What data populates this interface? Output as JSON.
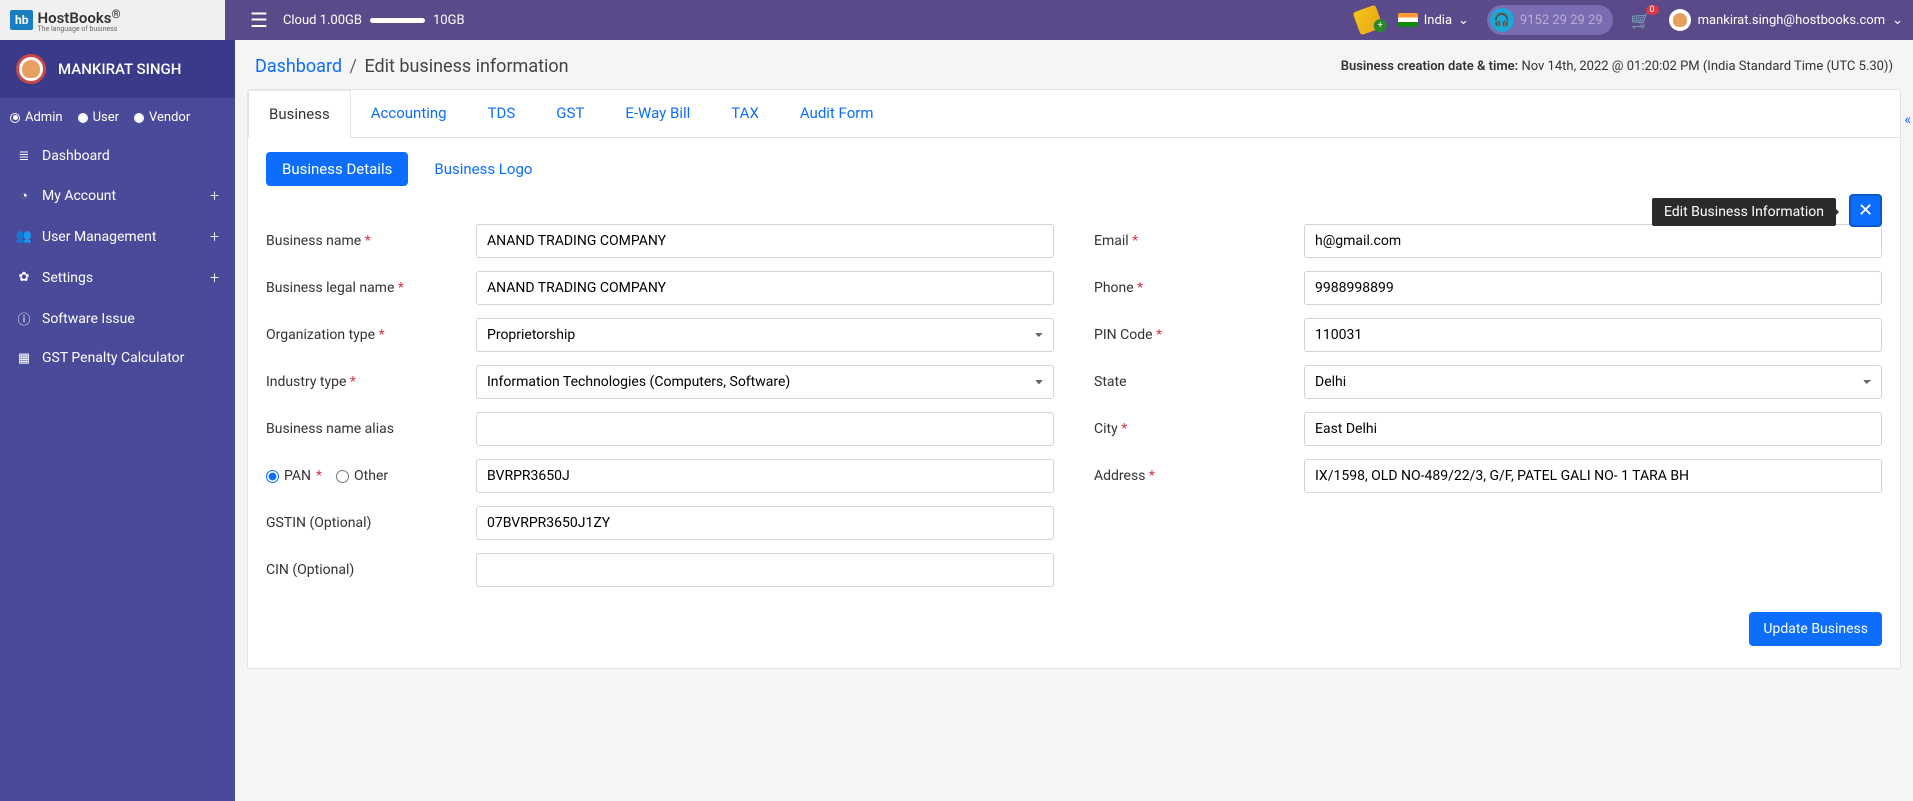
{
  "header": {
    "logo_badge": "hb",
    "logo_text": "HostBooks",
    "logo_sub": "The language of business",
    "cloud_used": "Cloud 1.00GB",
    "cloud_total": "10GB",
    "country_label": "India",
    "phone": "9152 29 29 29",
    "cart_count": "0",
    "user_email": "mankirat.singh@hostbooks.com"
  },
  "sidebar": {
    "user_name": "MANKIRAT SINGH",
    "roles": [
      "Admin",
      "User",
      "Vendor"
    ],
    "items": [
      {
        "icon": "≣",
        "label": "Dashboard",
        "expandable": false
      },
      {
        "icon": "◔",
        "label": "My Account",
        "expandable": true
      },
      {
        "icon": "👥",
        "label": "User Management",
        "expandable": true
      },
      {
        "icon": "✿",
        "label": "Settings",
        "expandable": true
      },
      {
        "icon": "ⓘ",
        "label": "Software Issue",
        "expandable": false
      },
      {
        "icon": "▦",
        "label": "GST Penalty Calculator",
        "expandable": false
      }
    ]
  },
  "breadcrumb": {
    "root": "Dashboard",
    "current": "Edit business information",
    "creation_label": "Business creation date & time:",
    "creation_value": "Nov 14th, 2022 @ 01:20:02 PM (India Standard Time (UTC 5.30))"
  },
  "tabs": [
    "Business",
    "Accounting",
    "TDS",
    "GST",
    "E-Way Bill",
    "TAX",
    "Audit Form"
  ],
  "subtabs": [
    "Business Details",
    "Business Logo"
  ],
  "tooltip": "Edit Business Information",
  "form": {
    "left": {
      "business_name_label": "Business name",
      "business_name": "ANAND TRADING COMPANY",
      "legal_name_label": "Business legal name",
      "legal_name": "ANAND TRADING COMPANY",
      "org_type_label": "Organization type",
      "org_type": "Proprietorship",
      "industry_label": "Industry type",
      "industry": "Information Technologies (Computers, Software)",
      "alias_label": "Business name alias",
      "alias": "",
      "pan_label": "PAN",
      "other_label": "Other",
      "pan": "BVRPR3650J",
      "gstin_label": "GSTIN (Optional)",
      "gstin": "07BVRPR3650J1ZY",
      "cin_label": "CIN (Optional)",
      "cin": ""
    },
    "right": {
      "email_label": "Email",
      "email": "h@gmail.com",
      "phone_label": "Phone",
      "phone": "9988998899",
      "pin_label": "PIN Code",
      "pin": "110031",
      "state_label": "State",
      "state": "Delhi",
      "city_label": "City",
      "city": "East Delhi",
      "address_label": "Address",
      "address": "IX/1598, OLD NO-489/22/3, G/F, PATEL GALI NO- 1 TARA BH"
    }
  },
  "actions": {
    "update": "Update Business"
  }
}
